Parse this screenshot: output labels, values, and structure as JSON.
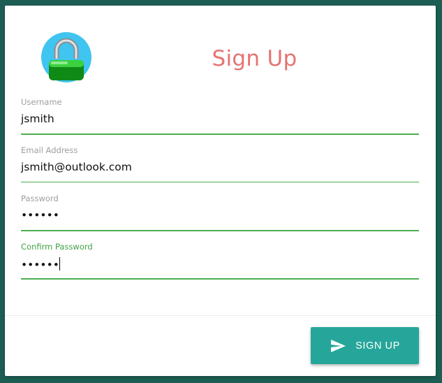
{
  "header": {
    "title": "Sign Up",
    "logo_icon": "padlock-icon"
  },
  "form": {
    "username": {
      "label": "Username",
      "value": "jsmith"
    },
    "email": {
      "label": "Email Address",
      "value": "jsmith@outlook.com"
    },
    "password": {
      "label": "Password",
      "value": "••••••"
    },
    "confirm_password": {
      "label": "Confirm Password",
      "value": "••••••"
    }
  },
  "actions": {
    "signup_label": "SIGN UP",
    "signup_icon": "send-icon"
  },
  "colors": {
    "background": "#1d5e54",
    "title": "#e57373",
    "underline": "#4caf50",
    "button": "#26a69a"
  }
}
